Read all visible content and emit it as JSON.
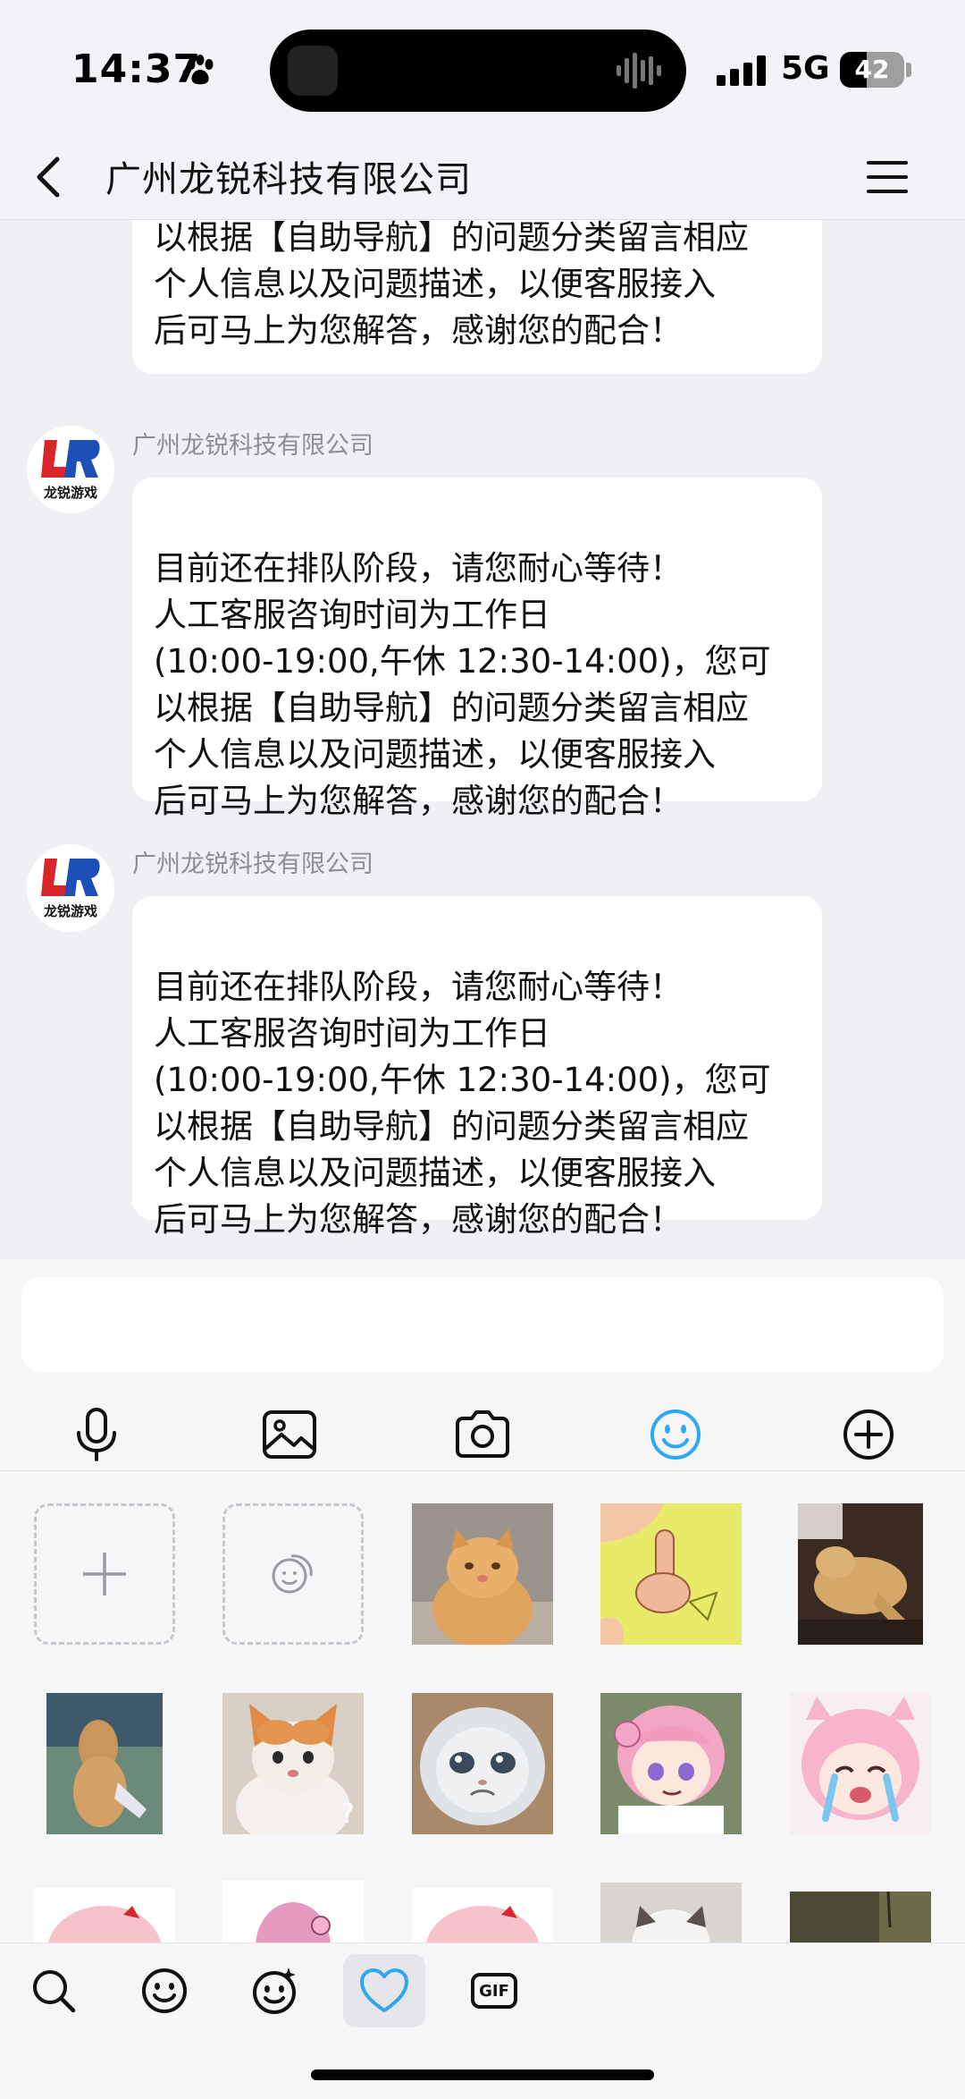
{
  "status_bar": {
    "time": "14:37",
    "network": "5G",
    "battery": "42",
    "battery_level_percent": 42
  },
  "header": {
    "title": "广州龙锐科技有限公司"
  },
  "messages": [
    {
      "partial": true,
      "text": "以根据【自助导航】的问题分类留言相应\n个人信息以及问题描述，以便客服接入\n后可马上为您解答，感谢您的配合！"
    },
    {
      "sender": "广州龙锐科技有限公司",
      "avatar_text": "龙锐游戏",
      "text": "目前还在排队阶段，请您耐心等待！\n人工客服咨询时间为工作日\n(10:00-19:00,午休 12:30-14:00)，您可\n以根据【自助导航】的问题分类留言相应\n个人信息以及问题描述，以便客服接入\n后可马上为您解答，感谢您的配合！"
    },
    {
      "sender": "广州龙锐科技有限公司",
      "avatar_text": "龙锐游戏",
      "text": "目前还在排队阶段，请您耐心等待！\n人工客服咨询时间为工作日\n(10:00-19:00,午休 12:30-14:00)，您可\n以根据【自助导航】的问题分类留言相应\n个人信息以及问题描述，以便客服接入\n后可马上为您解答，感谢您的配合！"
    }
  ],
  "composer": {
    "placeholder": "",
    "toolbar": [
      "microphone-icon",
      "image-icon",
      "camera-icon",
      "emoji-icon",
      "plus-circle-icon"
    ],
    "active_tool": "emoji-icon",
    "accent_color": "#2fa8f0"
  },
  "stickers": {
    "items": [
      "add-sticker",
      "sticker-manage",
      "orange-cat",
      "middle-finger-cartoon",
      "sleeping-dog",
      "dog-standing",
      "cat-question",
      "crying-cat",
      "anime-girl-pink-hair",
      "anime-girl-crying"
    ],
    "question_mark": "?"
  },
  "tabs": {
    "items": [
      "search-icon",
      "smiley-icon",
      "sparkle-face-icon",
      "favorites-heart-icon",
      "gif-icon"
    ],
    "gif_label": "GIF",
    "active": "favorites-heart-icon"
  }
}
